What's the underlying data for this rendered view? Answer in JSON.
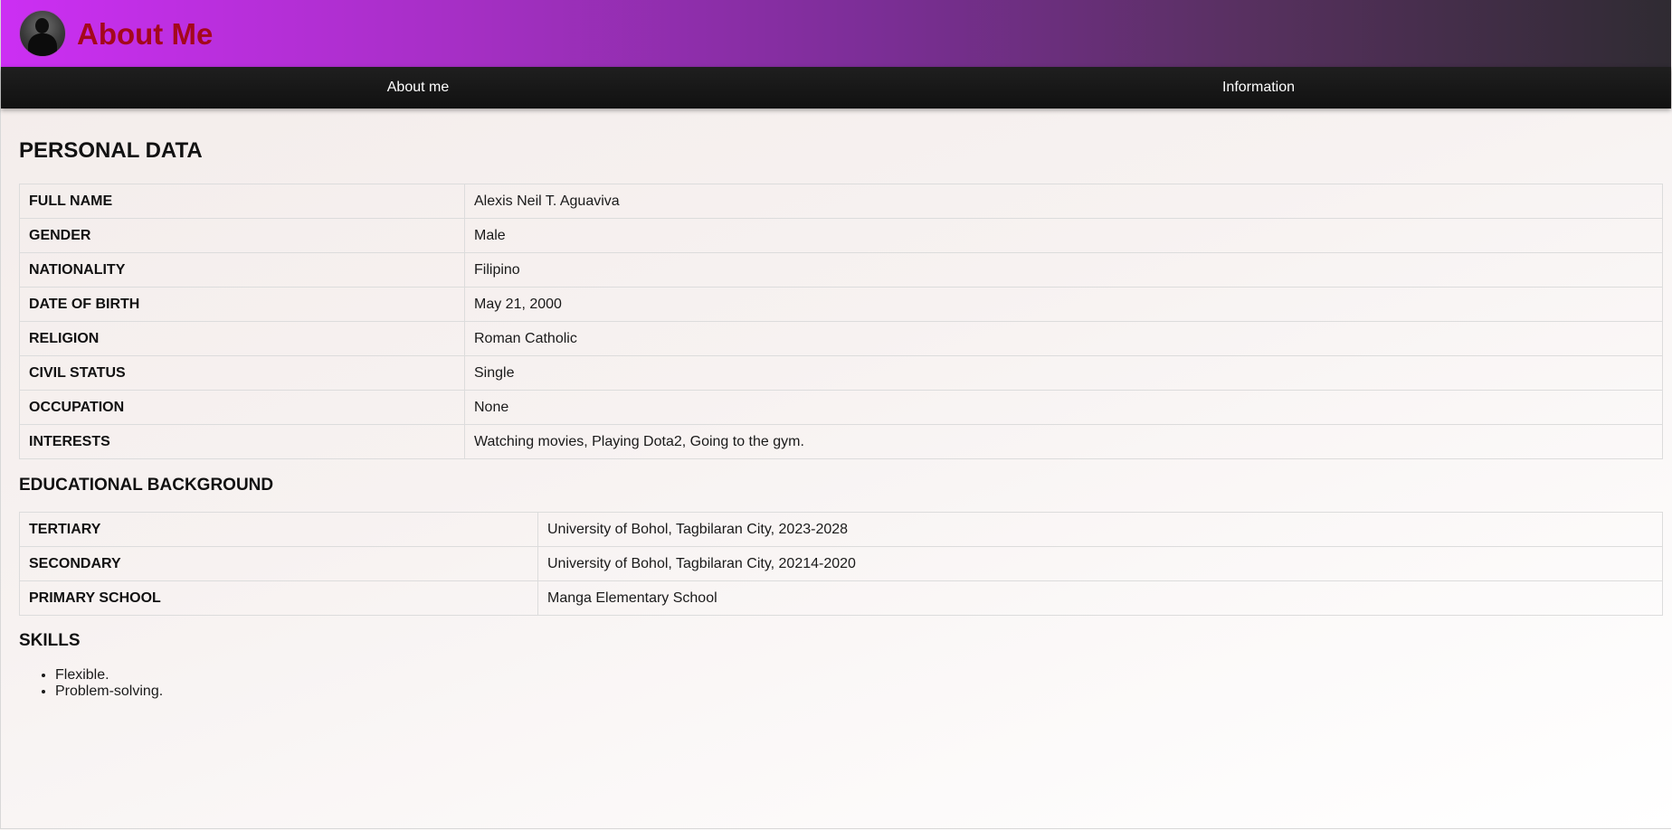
{
  "header": {
    "title": "About Me",
    "title_color": "#a4081c",
    "avatar_icon": "profile-photo"
  },
  "nav": {
    "items": [
      {
        "label": "About me"
      },
      {
        "label": "Information"
      }
    ]
  },
  "personal": {
    "heading": "PERSONAL DATA",
    "rows": [
      {
        "label": "FULL NAME",
        "value": "Alexis Neil T. Aguaviva"
      },
      {
        "label": "GENDER",
        "value": "Male"
      },
      {
        "label": "NATIONALITY",
        "value": "Filipino"
      },
      {
        "label": "DATE OF BIRTH",
        "value": "May 21, 2000"
      },
      {
        "label": "RELIGION",
        "value": "Roman Catholic"
      },
      {
        "label": "CIVIL STATUS",
        "value": "Single"
      },
      {
        "label": "OCCUPATION",
        "value": "None"
      },
      {
        "label": "INTERESTS",
        "value": "Watching movies, Playing Dota2, Going to the gym."
      }
    ]
  },
  "education": {
    "heading": "EDUCATIONAL BACKGROUND",
    "rows": [
      {
        "label": "TERTIARY",
        "value": "University of Bohol, Tagbilaran City, 2023-2028"
      },
      {
        "label": "SECONDARY",
        "value": "University of Bohol, Tagbilaran City, 20214-2020"
      },
      {
        "label": "PRIMARY SCHOOL",
        "value": "Manga Elementary School"
      }
    ]
  },
  "skills": {
    "heading": "SKILLS",
    "items": [
      "Flexible.",
      "Problem-solving."
    ]
  }
}
